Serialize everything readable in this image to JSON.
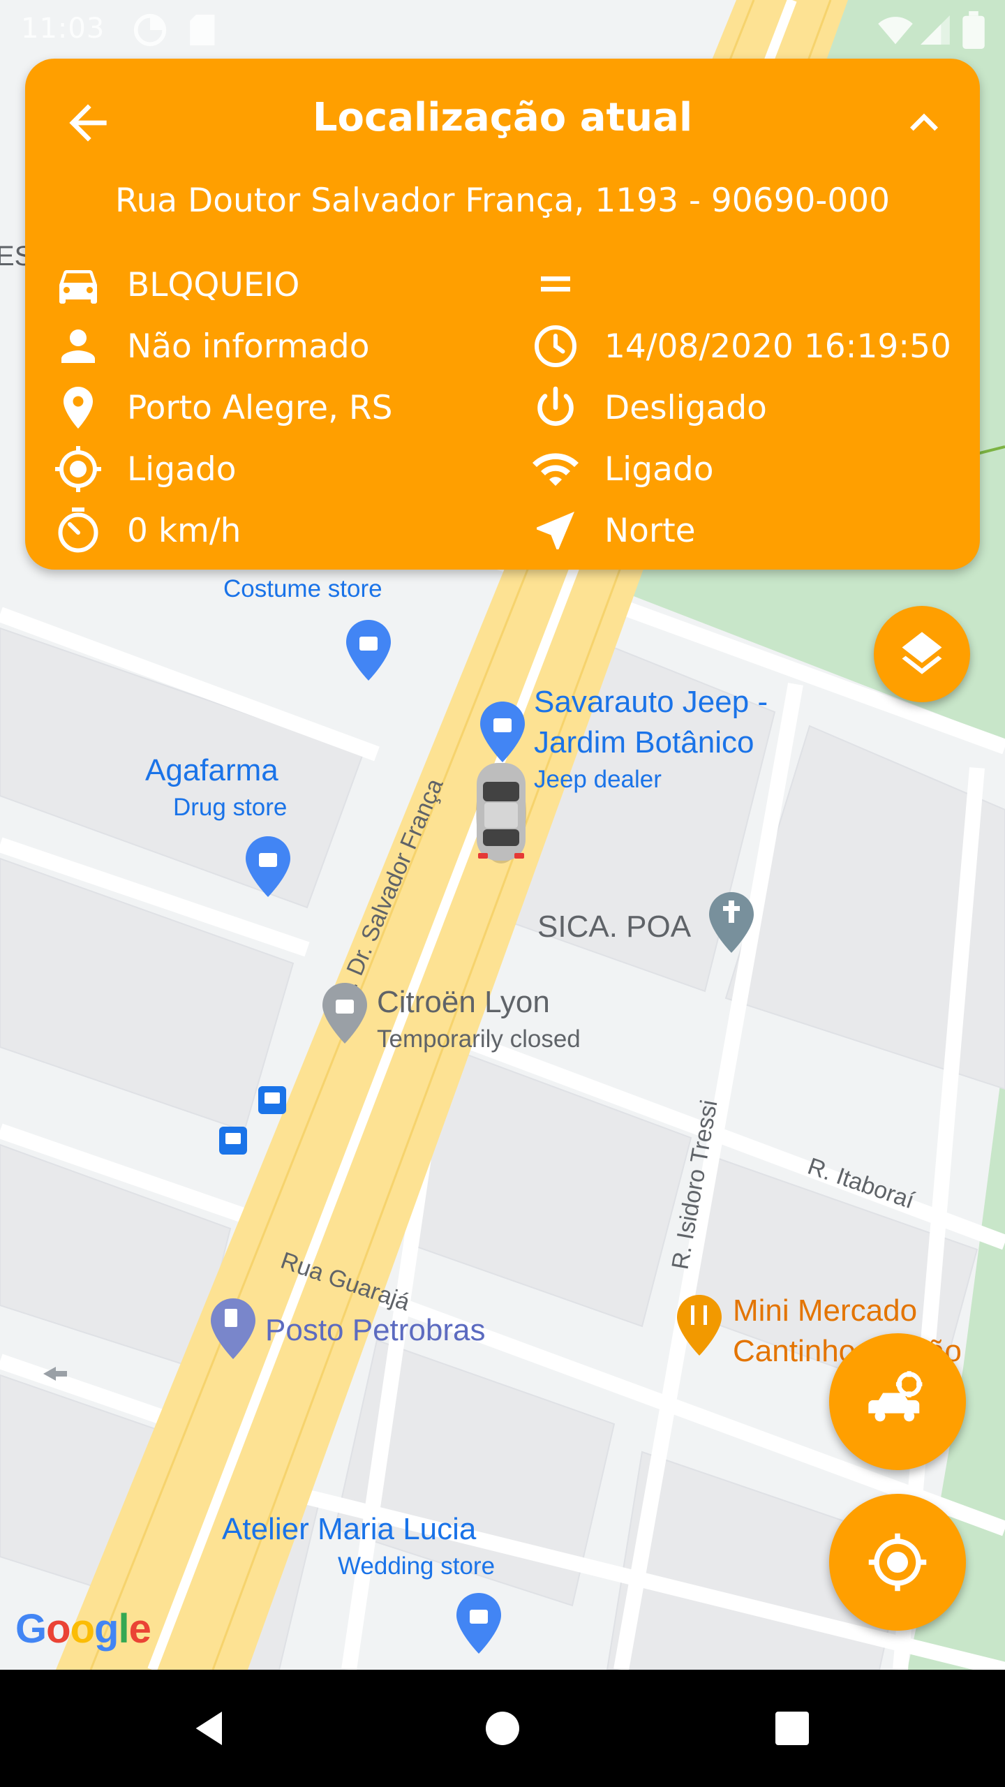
{
  "status_bar": {
    "time": "11:03"
  },
  "info_card": {
    "title": "Localização atual",
    "address": "Rua Doutor Salvador França, 1193 - 90690-000",
    "left_rows": [
      {
        "icon": "car-icon",
        "text": "BLQQUEIO"
      },
      {
        "icon": "person-icon",
        "text": "Não informado"
      },
      {
        "icon": "location-pin-icon",
        "text": "Porto Alegre, RS"
      },
      {
        "icon": "gps-target-icon",
        "text": "Ligado"
      },
      {
        "icon": "speedometer-icon",
        "text": "0 km/h"
      }
    ],
    "right_rows": [
      {
        "icon": "equals-icon",
        "text": ""
      },
      {
        "icon": "clock-icon",
        "text": "14/08/2020 16:19:50"
      },
      {
        "icon": "power-icon",
        "text": "Desligado"
      },
      {
        "icon": "wifi-icon",
        "text": "Ligado"
      },
      {
        "icon": "navigation-arrow-icon",
        "text": "Norte"
      }
    ]
  },
  "map": {
    "places": [
      {
        "name": "Costume store",
        "sub": ""
      },
      {
        "name": "Savarauto Jeep -",
        "name2": "Jardim Botânico",
        "sub": "Jeep dealer"
      },
      {
        "name": "Agafarma",
        "sub": "Drug store"
      },
      {
        "name": "SICA. POA",
        "sub": ""
      },
      {
        "name": "Citroën Lyon",
        "sub": "Temporarily closed"
      },
      {
        "name": "Posto Petrobras",
        "sub": ""
      },
      {
        "name": "Mini Mercado",
        "name2": "Cantinho do Pão",
        "sub": ""
      },
      {
        "name": "Atelier Maria Lucia",
        "sub": "Wedding store"
      },
      {
        "name": "ES",
        "sub": ""
      }
    ],
    "streets": [
      "R. Dr. Salvador França",
      "Rua Guarajá",
      "R. Isidoro Tressi",
      "R. Itaboraí"
    ],
    "attribution": "Google"
  },
  "colors": {
    "accent": "#ff9f00",
    "road": "#fde293",
    "park": "#c8e6c9",
    "poi_blue": "#1a73e8",
    "poi_orange": "#e37400"
  }
}
